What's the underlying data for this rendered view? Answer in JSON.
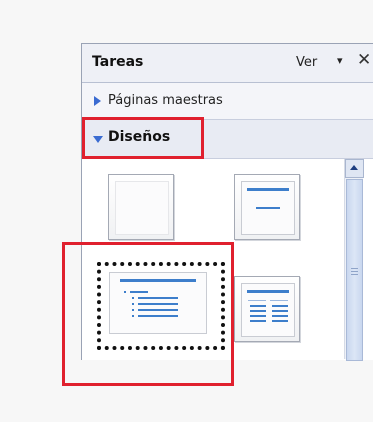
{
  "panel": {
    "title": "Tareas",
    "view_label": "Ver",
    "view_arrow": "▾",
    "close_label": "✕"
  },
  "sections": {
    "master_pages": "Páginas maestras",
    "layouts": "Diseños"
  },
  "layouts": [
    {
      "name": "layout-blank"
    },
    {
      "name": "layout-title-only"
    },
    {
      "name": "layout-title-content"
    },
    {
      "name": "layout-two-content"
    }
  ],
  "highlight_color": "#e0202e",
  "accent_color": "#3d7ecb"
}
